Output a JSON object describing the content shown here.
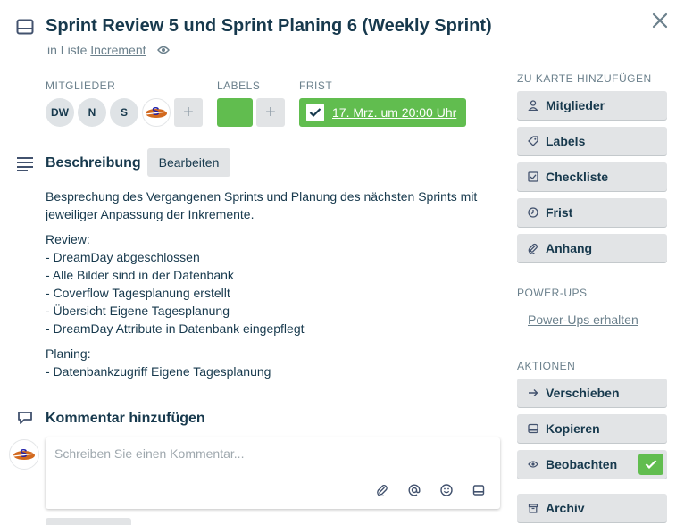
{
  "header": {
    "title": "Sprint Review 5 und Sprint Planing 6 (Weekly Sprint)",
    "list_prefix": "in Liste ",
    "list_name": "Increment"
  },
  "meta": {
    "members_label": "MITGLIEDER",
    "members": [
      "DW",
      "N",
      "S"
    ],
    "labels_label": "LABELS",
    "label_color": "#61bd4f",
    "due_label": "FRIST",
    "due_text": "17. Mrz. um 20:00 Uhr"
  },
  "description": {
    "heading": "Beschreibung",
    "edit_label": "Bearbeiten",
    "lines": [
      "Besprechung des Vergangenen Sprints und Planung des nächsten Sprints mit",
      "jeweiliger Anpassung der Inkremente.",
      "Review:",
      "- DreamDay abgeschlossen",
      "- Alle Bilder sind in der Datenbank",
      "- Coverflow Tagesplanung erstellt",
      "- Übersicht Eigene Tagesplanung",
      "- DreamDay Attribute in Datenbank eingepflegt",
      "Planing:",
      "- Datenbankzugriff Eigene Tagesplanung"
    ]
  },
  "comment": {
    "heading": "Kommentar hinzufügen",
    "placeholder": "Schreiben Sie einen Kommentar..."
  },
  "sidebar": {
    "add_heading": "ZU KARTE HINZUFÜGEN",
    "add_items": [
      {
        "label": "Mitglieder",
        "icon": "person-icon"
      },
      {
        "label": "Labels",
        "icon": "tag-icon"
      },
      {
        "label": "Checkliste",
        "icon": "checkbox-icon"
      },
      {
        "label": "Frist",
        "icon": "clock-icon"
      },
      {
        "label": "Anhang",
        "icon": "paperclip-icon"
      }
    ],
    "powerups_heading": "POWER-UPS",
    "powerups_link": "Power-Ups erhalten",
    "actions_heading": "AKTIONEN",
    "actions": [
      {
        "label": "Verschieben",
        "icon": "arrow-right-icon"
      },
      {
        "label": "Kopieren",
        "icon": "card-icon"
      },
      {
        "label": "Beobachten",
        "icon": "eye-icon",
        "checked": true
      },
      {
        "label": "Archiv",
        "icon": "archive-icon"
      }
    ]
  },
  "colors": {
    "accent_green": "#61bd4f",
    "text": "#17394d",
    "muted": "#6b808c",
    "button_bg": "#e2e4e6"
  }
}
